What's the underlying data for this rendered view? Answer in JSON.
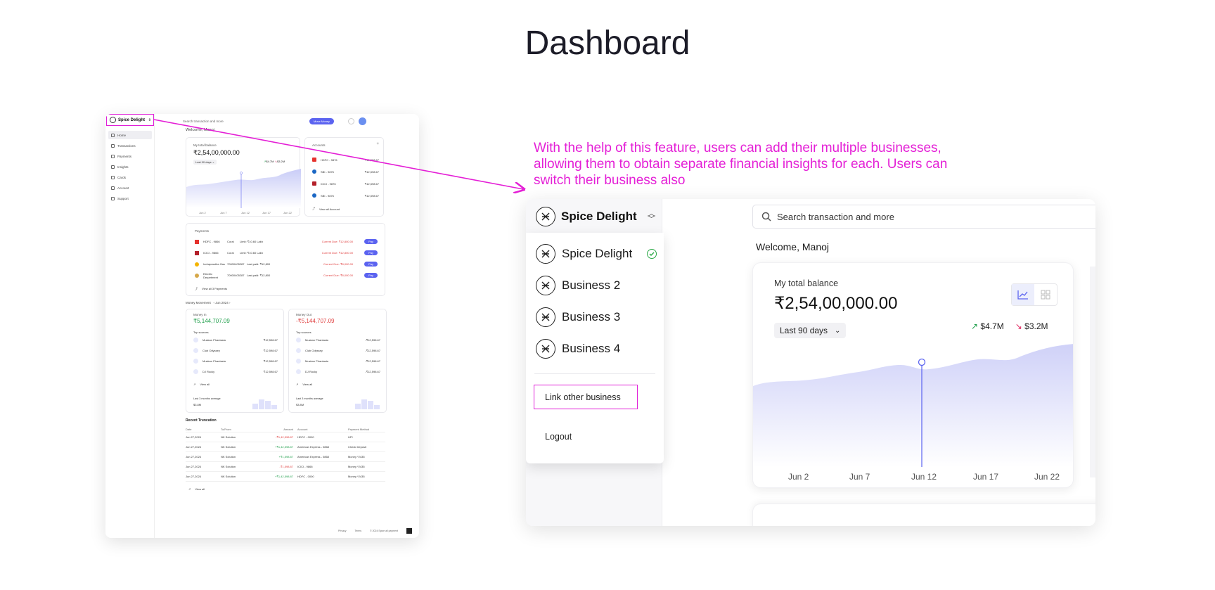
{
  "page": {
    "title": "Dashboard"
  },
  "note": "With the help of this feature, users can add their multiple businesses, allowing them to obtain separate financial insights for each. Users can switch their business also",
  "colors": {
    "accent": "#5b63f0",
    "highlight": "#e41fd6",
    "up": "#1e9e4a",
    "down": "#e0245e",
    "check": "#29a845"
  },
  "mini": {
    "brand": "Spice Delight",
    "nav": [
      "Home",
      "Transactions",
      "Payments",
      "Insights",
      "Cards",
      "Account",
      "Support"
    ],
    "search_placeholder": "Search transaction and more",
    "move_money": "Move Money",
    "welcome": "Welcome, Manoj",
    "balance": {
      "label": "My total balance",
      "value": "₹2,54,00,000.00",
      "range": "Last 90 days",
      "up": "$4.7M",
      "down": "$3.2M",
      "x_labels": [
        "Jun 2",
        "Jun 7",
        "Jun 12",
        "Jun 17",
        "Jun 22"
      ]
    },
    "accounts": {
      "title": "Accounts",
      "rows": [
        {
          "name": "HDFC - 9876",
          "amount": "₹12,598.67",
          "color": "#e5322d"
        },
        {
          "name": "SBI - 9876",
          "amount": "₹12,598.67",
          "color": "#1b67c4"
        },
        {
          "name": "ICICI - 9876",
          "amount": "₹12,598.67",
          "color": "#b3202a"
        },
        {
          "name": "SBI - 9876",
          "amount": "₹12,598.67",
          "color": "#1b67c4"
        }
      ],
      "view_all": "View all Account"
    },
    "payments": {
      "title": "Payments",
      "rows": [
        {
          "name": "HDFC - 9866",
          "tag": "Coral",
          "limit": "Limit: ₹10.60 Lakh",
          "due": "Current Due: ₹12,800.00",
          "btn": "Pay"
        },
        {
          "name": "ICICI - 9866",
          "tag": "Coral",
          "limit": "Limit: ₹10.60 Lakh",
          "due": "Current Due: ₹12,800.00",
          "btn": "Pay"
        },
        {
          "name": "Indraprastha Gas",
          "tag": "70000405287",
          "limit": "Last paid: ₹12,800",
          "due": "Current Due: ₹8,000.00",
          "btn": "Pay"
        },
        {
          "name": "Electric Department",
          "tag": "70000405287",
          "limit": "Last paid: ₹12,800",
          "due": "Current Due: ₹8,000.00",
          "btn": "Pay"
        }
      ],
      "view_all": "View all 3 Payments"
    },
    "money_movement": {
      "label": "Money Movement",
      "month": "Jun 2024"
    },
    "money_in": {
      "title": "Money In",
      "value": "₹5,144,707.09",
      "sources_label": "Top sources",
      "rows": [
        "Muskan Phantasia",
        "Club Odyssey",
        "Muskan Phantasia",
        "DJ Rocky"
      ],
      "amount": "₹12,598.67",
      "view_all": "View all",
      "avg_label": "Last 3 months average",
      "avg": "$3.8M"
    },
    "money_out": {
      "title": "Money Out",
      "value": "-₹5,144,707.09",
      "sources_label": "Top sources",
      "rows": [
        "Muskan Phantasia",
        "Club Odyssey",
        "Muskan Phantasia",
        "DJ Rocky"
      ],
      "amount": "-₹12,598.67",
      "view_all": "View all",
      "avg_label": "Last 3 months average",
      "avg": "$3.8M"
    },
    "recent": {
      "title": "Recent Truncation",
      "headers": [
        "Date",
        "To/From",
        "Amount",
        "Account",
        "Payment Method"
      ],
      "rows": [
        [
          "Jun 27,2024",
          "NK Solution",
          "-₹1,42,598.87",
          "HDFC - 0000",
          "UPI"
        ],
        [
          "Jun 27,2024",
          "NK Solution",
          "+₹1,42,598.87",
          "American Express - 0868",
          "Check Deposit"
        ],
        [
          "Jun 27,2024",
          "NK Solution",
          "+₹1,598.87",
          "American Express - 0868",
          "Money *2435"
        ],
        [
          "Jun 27,2024",
          "NK Solution",
          "-₹1,598.87",
          "ICICI - 9866",
          "Money *2435"
        ],
        [
          "Jun 27,2024",
          "NK Solution",
          "+₹1,42,598.87",
          "HDFC - 0000",
          "Money *2435"
        ]
      ],
      "view_all": "View all"
    },
    "footer": [
      "Privacy",
      "Terms",
      "© 2024 Spice all payment"
    ]
  },
  "zoom": {
    "brand": "Spice Delight",
    "businesses": [
      "Spice Delight",
      "Business 2",
      "Business 3",
      "Business 4"
    ],
    "link_other": "Link other business",
    "logout": "Logout",
    "search_placeholder": "Search transaction and more",
    "welcome": "Welcome, Manoj",
    "balance": {
      "label": "My total balance",
      "value": "₹2,54,00,000.00",
      "range": "Last 90 days",
      "up": "$4.7M",
      "down": "$3.2M",
      "x_labels": [
        "Jun 2",
        "Jun 7",
        "Jun 12",
        "Jun 17",
        "Jun 22"
      ]
    }
  },
  "icons": [
    "logo-icon",
    "chevron-updown-icon",
    "check-circle-icon",
    "search-icon",
    "line-chart-icon",
    "grid-icon",
    "chevron-down-icon",
    "arrow-up-right-icon",
    "arrow-down-right-icon"
  ]
}
